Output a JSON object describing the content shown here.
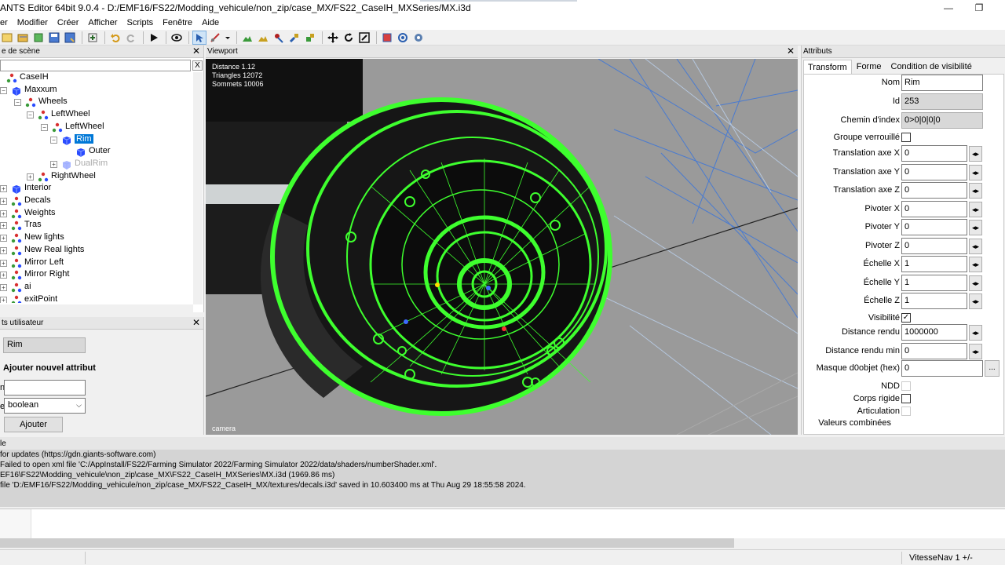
{
  "window": {
    "title": "ANTS Editor 64bit 9.0.4 - D:/EMF16/FS22/Modding_vehicule/non_zip/case_MX/FS22_CaseIH_MXSeries/MX.i3d",
    "minimize": "—",
    "maximize": "❐"
  },
  "menu": [
    "er",
    "Modifier",
    "Créer",
    "Afficher",
    "Scripts",
    "Fenêtre",
    "Aide"
  ],
  "scene_panel": {
    "title": "e de scène",
    "close": "✕",
    "search_clear": "X",
    "nodes": [
      {
        "label": "CaseIH",
        "type": "transform",
        "pm": "",
        "depth": 0
      },
      {
        "label": "Maxxum",
        "type": "shape",
        "pm": "−",
        "depth": 1
      },
      {
        "label": "Wheels",
        "type": "transform",
        "pm": "−",
        "depth": 2
      },
      {
        "label": "LeftWheel",
        "type": "transform",
        "pm": "−",
        "depth": 3
      },
      {
        "label": "LeftWheel",
        "type": "transform",
        "pm": "−",
        "depth": 4
      },
      {
        "label": "Rim",
        "type": "shape",
        "pm": "−",
        "depth": 5,
        "selected": true
      },
      {
        "label": "Outer",
        "type": "shape",
        "pm": "",
        "depth": 6
      },
      {
        "label": "DualRim",
        "type": "shape",
        "pm": "+",
        "depth": 5,
        "hidden": true
      },
      {
        "label": "RightWheel",
        "type": "transform",
        "pm": "+",
        "depth": 3
      },
      {
        "label": "Interior",
        "type": "shape",
        "pm": "+",
        "depth": 1
      },
      {
        "label": "Decals",
        "type": "transform",
        "pm": "+",
        "depth": 1
      },
      {
        "label": "Weights",
        "type": "transform",
        "pm": "+",
        "depth": 1
      },
      {
        "label": "Tras",
        "type": "transform",
        "pm": "+",
        "depth": 1
      },
      {
        "label": "New lights",
        "type": "transform",
        "pm": "+",
        "depth": 1
      },
      {
        "label": "New Real lights",
        "type": "transform",
        "pm": "+",
        "depth": 1
      },
      {
        "label": "Mirror Left",
        "type": "transform",
        "pm": "+",
        "depth": 1
      },
      {
        "label": "Mirror Right",
        "type": "transform",
        "pm": "+",
        "depth": 1
      },
      {
        "label": "ai",
        "type": "transform",
        "pm": "+",
        "depth": 1
      },
      {
        "label": "exitPoint",
        "type": "transform",
        "pm": "+",
        "depth": 1
      }
    ]
  },
  "user_attrs": {
    "title": "ts utilisateur",
    "close": "✕",
    "node_name": "Rim",
    "add_heading": "Ajouter nouvel attribut",
    "name_prefix": "n",
    "type_prefix": "e",
    "type_value": "boolean",
    "add_button": "Ajouter"
  },
  "viewport": {
    "title": "Viewport",
    "close": "✕",
    "stats": [
      "Distance 1.12",
      "Triangles 12072",
      "Sommets 10006"
    ],
    "camera": "camera"
  },
  "attributes": {
    "title": "Attributs",
    "tabs": [
      "Transform",
      "Forme",
      "Condition de visibilité"
    ],
    "rows": [
      {
        "label": "Nom",
        "value": "Rim",
        "kind": "text"
      },
      {
        "label": "Id",
        "value": "253",
        "kind": "readonly"
      },
      {
        "label": "Chemin d'index",
        "value": "0>0|0|0|0",
        "kind": "readonly"
      },
      {
        "label": "Groupe verrouillé",
        "value": "",
        "kind": "check"
      },
      {
        "label": "Translation axe X",
        "value": "0",
        "kind": "spin"
      },
      {
        "label": "Translation axe Y",
        "value": "0",
        "kind": "spin"
      },
      {
        "label": "Translation axe Z",
        "value": "0",
        "kind": "spin"
      },
      {
        "label": "Pivoter X",
        "value": "0",
        "kind": "spin"
      },
      {
        "label": "Pivoter Y",
        "value": "0",
        "kind": "spin"
      },
      {
        "label": "Pivoter Z",
        "value": "0",
        "kind": "spin"
      },
      {
        "label": "Échelle X",
        "value": "1",
        "kind": "spin"
      },
      {
        "label": "Échelle Y",
        "value": "1",
        "kind": "spin"
      },
      {
        "label": "Échelle Z",
        "value": "1",
        "kind": "spin"
      },
      {
        "label": "Visibilité",
        "value": "✓",
        "kind": "check"
      },
      {
        "label": "Distance rendu",
        "value": "1000000",
        "kind": "spin"
      },
      {
        "label": "Distance rendu min",
        "value": "0",
        "kind": "spin"
      },
      {
        "label": "Masque d0objet (hex)",
        "value": "0",
        "kind": "dots"
      },
      {
        "label": "NDD",
        "value": "",
        "kind": "checkoff"
      },
      {
        "label": "Corps rigide",
        "value": "",
        "kind": "check"
      },
      {
        "label": "Articulation",
        "value": "",
        "kind": "checkoff"
      },
      {
        "label": "Valeurs combinées",
        "value": "",
        "kind": "label"
      }
    ]
  },
  "console": {
    "title": "le",
    "lines": [
      " for updates (https://gdn.giants-software.com)",
      " Failed to open xml file 'C:/AppInstall/FS22/Farming Simulator 2022/Farming Simulator 2022/data/shaders/numberShader.xml'.",
      "EF16\\FS22\\Modding_vehicule\\non_zip\\case_MX\\FS22_CaseIH_MXSeries\\MX.i3d (1969.86 ms)",
      "file 'D:/EMF16/FS22/Modding_vehicule/non_zip/case_MX/FS22_CaseIH_MX/textures/decals.i3d' saved in 10.603400 ms at Thu Aug 29 18:55:58 2024."
    ]
  },
  "status": {
    "nav_speed": "VitesseNav 1 +/-"
  }
}
